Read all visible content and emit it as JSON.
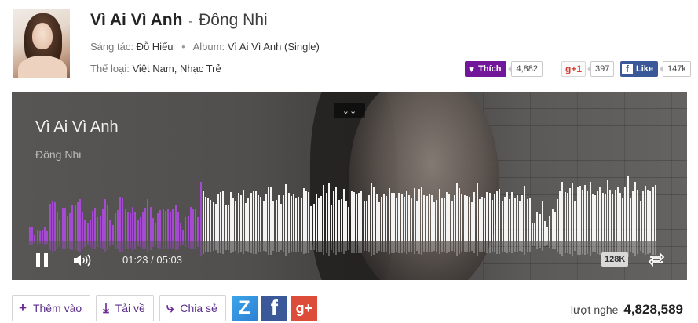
{
  "song": {
    "title": "Vì Ai Vì Anh",
    "separator": "-",
    "artist": "Đông Nhi",
    "composer_label": "Sáng tác:",
    "composer": "Đỗ Hiếu",
    "album_label": "Album:",
    "album": "Vì Ai Vì Anh (Single)",
    "genre_label": "Thể loại:",
    "genre": "Việt Nam, Nhạc Trẻ"
  },
  "social": {
    "like_label": "Thích",
    "like_count": "4,882",
    "gplus_label": "+1",
    "gplus_count": "397",
    "fb_label": "Like",
    "fb_count": "147k"
  },
  "player": {
    "title": "Vì Ai Vì Anh",
    "artist": "Đông Nhi",
    "time_current": "01:23",
    "time_separator": "/",
    "time_total": "05:03",
    "quality": "128K",
    "progress": 0.274,
    "colors": {
      "played": "#a54bd1",
      "unplayed": "#f4f4f4"
    }
  },
  "actions": {
    "add_label": "Thêm vào",
    "download_label": "Tải về",
    "share_label": "Chia sẻ",
    "share_targets": [
      "zing-icon",
      "facebook-icon",
      "google-plus-icon"
    ]
  },
  "stats": {
    "listen_label": "lượt nghe",
    "listen_count": "4,828,589"
  },
  "colors": {
    "accent": "#721799",
    "facebook": "#3b5998",
    "google": "#dd4b39"
  }
}
